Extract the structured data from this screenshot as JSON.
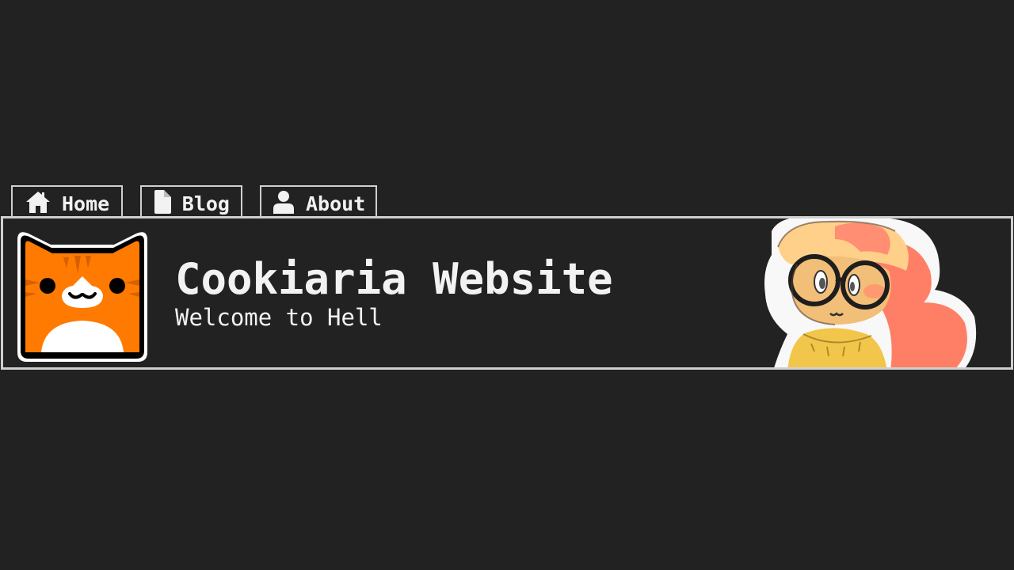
{
  "nav": {
    "tabs": [
      {
        "label": "Home",
        "icon": "home-icon"
      },
      {
        "label": "Blog",
        "icon": "document-icon"
      },
      {
        "label": "About",
        "icon": "user-icon"
      }
    ]
  },
  "banner": {
    "title": "Cookiaria Website",
    "subtitle": "Welcome to Hell",
    "logo_icon": "orange-cat-icon",
    "mascot_image": "character-illustration"
  },
  "colors": {
    "background": "#222222",
    "border": "#cfcfcf",
    "text": "#f2f2f2",
    "cat_orange": "#ff7a00"
  }
}
